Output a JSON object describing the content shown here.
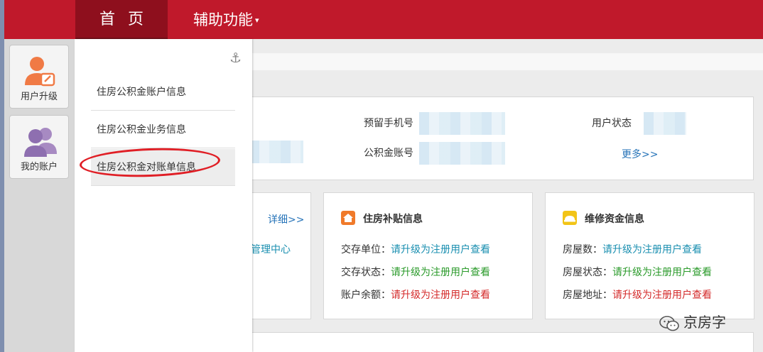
{
  "nav": {
    "home": "首页",
    "tools": "辅助功能",
    "tools_caret": "▾"
  },
  "sidebar": [
    {
      "label": "用户升级",
      "icon": "user-upgrade-icon"
    },
    {
      "label": "我的账户",
      "icon": "my-account-icon"
    }
  ],
  "dropdown": {
    "pin_icon": "anchor-icon",
    "items": [
      {
        "label": "住房公积金账户信息"
      },
      {
        "label": "住房公积金业务信息"
      },
      {
        "label": "住房公积金对账单信息"
      }
    ]
  },
  "info": {
    "phone_label": "预留手机号",
    "status_label": "用户状态",
    "account_label": "公积金账号",
    "more_link": "更多>>"
  },
  "card_left": {
    "detail_link": "详细>>",
    "partial_text": "管理中心"
  },
  "card_housing": {
    "title": "住房补贴信息",
    "rows": [
      {
        "label": "交存单位：",
        "value": "请升级为注册用户查看",
        "tone": "teal"
      },
      {
        "label": "交存状态：",
        "value": "请升级为注册用户查看",
        "tone": "green"
      },
      {
        "label": "账户余额：",
        "value": "请升级为注册用户查看",
        "tone": "red"
      }
    ]
  },
  "card_repair": {
    "title": "维修资金信息",
    "rows": [
      {
        "label": "房屋数：",
        "value": "请升级为注册用户查看",
        "tone": "teal"
      },
      {
        "label": "房屋状态：",
        "value": "请升级为注册用户查看",
        "tone": "green"
      },
      {
        "label": "房屋地址：",
        "value": "请升级为注册用户查看",
        "tone": "red"
      }
    ]
  },
  "watermark": "京房字",
  "colors": {
    "brand_red": "#c0192b",
    "nav_active": "#8e0f1d",
    "teal": "#1a8fb0",
    "green": "#2a9a2a",
    "red": "#d42a2a"
  }
}
